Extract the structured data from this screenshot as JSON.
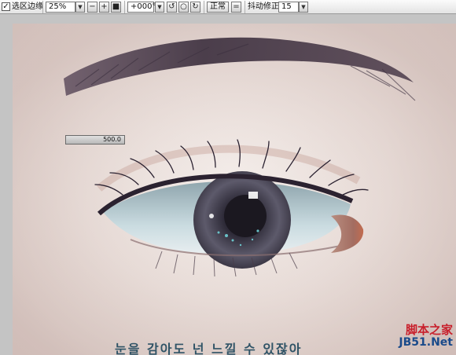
{
  "toolbar": {
    "selection_edge_checked": "✓",
    "selection_edge_label": "选区边缘",
    "zoom_value": "25%",
    "rotation_value": "+000°",
    "blend_mode": "正常",
    "stabilizer_label": "抖动修正",
    "stabilizer_value": "15",
    "icons": [
      "dropdown-arrow-icon",
      "zoom-out-icon",
      "zoom-in-icon",
      "zoom-fit-icon",
      "rotate-left-icon",
      "rotate-reset-icon",
      "rotate-right-icon",
      "flip-icon"
    ]
  },
  "canvas": {
    "slider_value": "500.0",
    "caption_text": "눈을 감아도 넌 느낄 수 있잖아"
  },
  "watermark": {
    "line1": "脚本之家",
    "line2": "JB51.Net"
  },
  "colors": {
    "skin": "#ece3df",
    "iris": "#5b5a67",
    "brow": "#4a3f4a",
    "caption": "#2f5366",
    "watermark_red": "#c81f2b",
    "watermark_blue": "#1a4a8a"
  }
}
